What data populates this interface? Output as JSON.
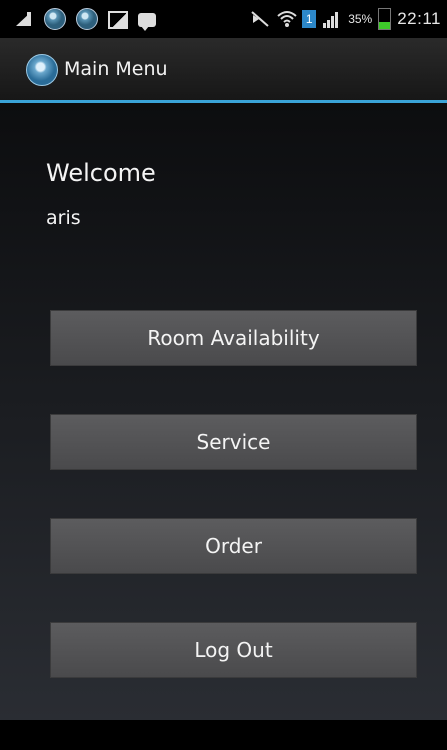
{
  "status_bar": {
    "icons": [
      "notification-triangle-icon",
      "app-circle-icon",
      "app-circle-icon",
      "image-icon",
      "bbm-chat-icon",
      "mute-icon",
      "wifi-icon",
      "sim-1-icon",
      "signal-icon",
      "battery-icon"
    ],
    "sim_label": "1",
    "battery_percent": "35%",
    "battery_level": 0.35,
    "battery_color": "#3ecb2a",
    "time": "22:11"
  },
  "action_bar": {
    "title": "Main Menu",
    "accent_color": "#3aa3d8"
  },
  "main": {
    "welcome_label": "Welcome",
    "username": "aris",
    "buttons": [
      {
        "label": "Room Availability"
      },
      {
        "label": "Service"
      },
      {
        "label": "Order"
      },
      {
        "label": "Log Out"
      }
    ]
  }
}
